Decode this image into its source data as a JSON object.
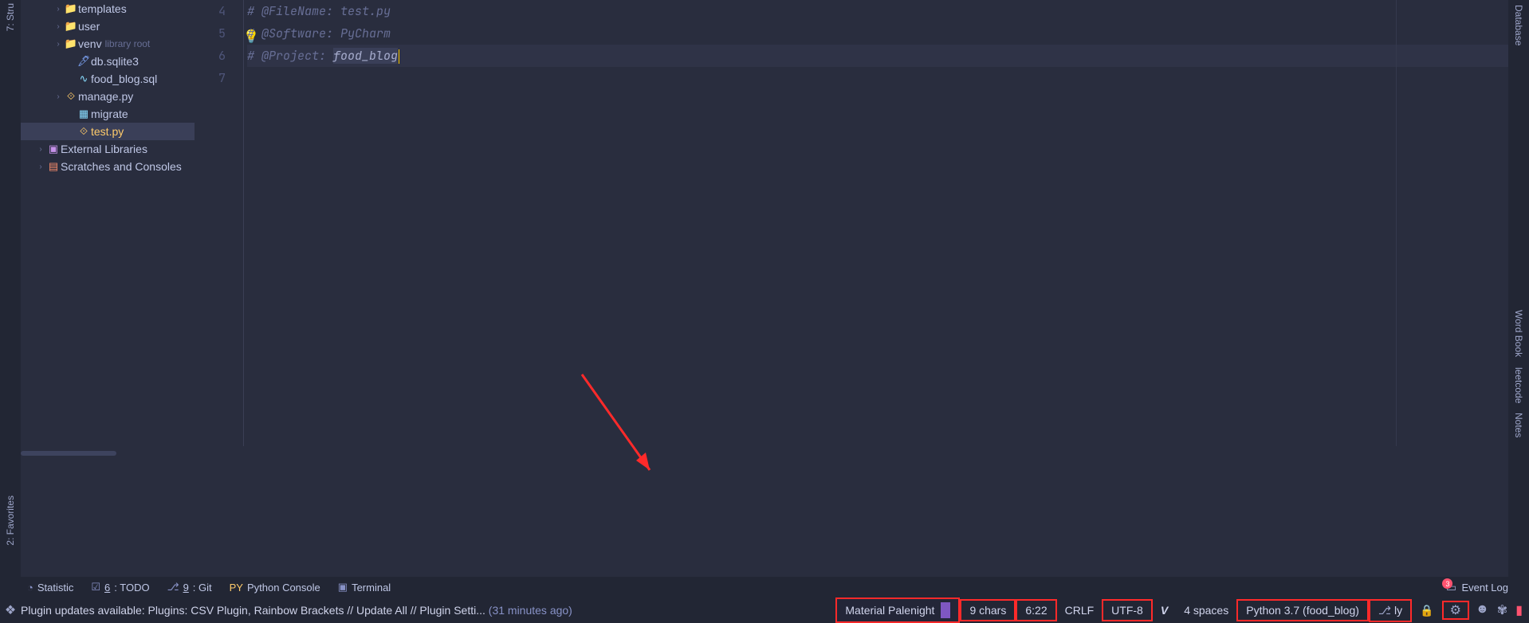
{
  "left_strip": {
    "top_label": "7: Stru",
    "bottom_label": "2: Favorites"
  },
  "right_strip": {
    "items": [
      "Database",
      "Word Book",
      "leetcode",
      "Notes"
    ]
  },
  "tree": {
    "items": [
      {
        "indent": 1,
        "arrow": ">",
        "icon": "folder-y",
        "label": "templates"
      },
      {
        "indent": 1,
        "arrow": ">",
        "icon": "folder-y",
        "label": "user"
      },
      {
        "indent": 1,
        "arrow": ">",
        "icon": "folder-b",
        "label": "venv",
        "hint": "library root"
      },
      {
        "indent": 2,
        "arrow": "",
        "icon": "db",
        "label": "db.sqlite3"
      },
      {
        "indent": 2,
        "arrow": "",
        "icon": "sql",
        "label": "food_blog.sql"
      },
      {
        "indent": 1,
        "arrow": ">",
        "icon": "py",
        "label": "manage.py"
      },
      {
        "indent": 2,
        "arrow": "",
        "icon": "mig",
        "label": "migrate"
      },
      {
        "indent": 2,
        "arrow": "",
        "icon": "py",
        "label": "test.py",
        "selected": true
      },
      {
        "indent": 0,
        "arrow": ">",
        "icon": "lib",
        "label": "External Libraries"
      },
      {
        "indent": 0,
        "arrow": ">",
        "icon": "scr",
        "label": "Scratches and Consoles"
      }
    ]
  },
  "editor": {
    "lines": [
      {
        "n": 4,
        "text": "# @FileName: test.py"
      },
      {
        "n": 5,
        "text": "# @Software: PyCharm",
        "bulb": true
      },
      {
        "n": 6,
        "prefix": "# @Project: ",
        "word": "food_blog",
        "highlighted": true,
        "fold": true
      },
      {
        "n": 7,
        "text": ""
      }
    ]
  },
  "tool_tabs": {
    "statistic": "Statistic",
    "todo_pre": "6",
    "todo": ": TODO",
    "git_pre": "9",
    "git": ": Git",
    "py_console": "Python Console",
    "terminal": "Terminal",
    "event_log": "Event Log",
    "badge": "3"
  },
  "status": {
    "msg_prefix": "Plugin updates available: Plugins: CSV Plugin, Rainbow Brackets // Update All // Plugin Setti... ",
    "msg_time": "(31 minutes ago)",
    "theme": "Material Palenight",
    "chars": "9 chars",
    "pos": "6:22",
    "eol": "CRLF",
    "enc": "UTF-8",
    "indent": "4 spaces",
    "interpreter": "Python 3.7 (food_blog)",
    "branch": "ly"
  }
}
